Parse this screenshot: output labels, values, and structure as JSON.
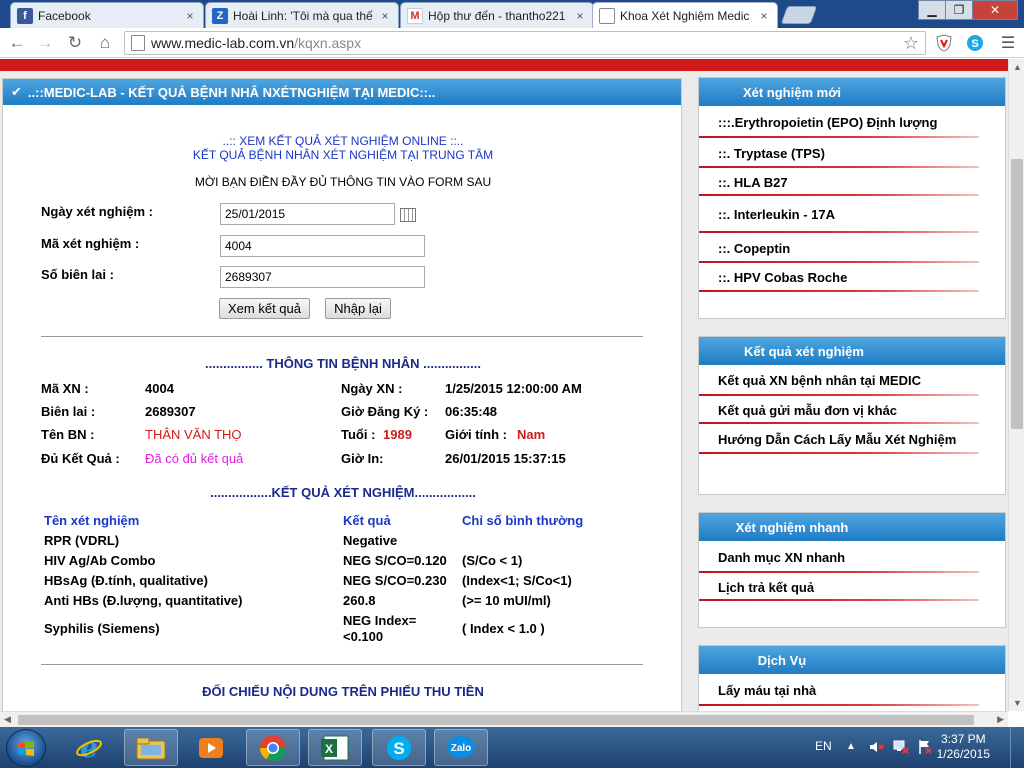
{
  "browser": {
    "tabs": [
      {
        "title": "Facebook",
        "favicon": "f",
        "color": "#3b5998"
      },
      {
        "title": "Hoài Linh: 'Tôi mà qua thế",
        "favicon": "Z",
        "color": "#1e66c8"
      },
      {
        "title": "Hộp thư đến - thantho221",
        "favicon": "M",
        "color": "#d93025"
      },
      {
        "title": "Khoa Xét Nghiệm Medic -",
        "favicon": "",
        "color": "#ffffff"
      }
    ],
    "close_glyph": "×",
    "url_host": "www.medic-lab.com.vn",
    "url_path": "/kqxn.aspx"
  },
  "main": {
    "header": "..::MEDIC-LAB   -   KẾT QUẢ BỆNH NHÂ NXÉTNGHIỆM TẠI MEDIC::..",
    "intro_line1": "..:: XEM KẾT QUẢ XÉT NGHIỆM ONLINE ::..",
    "intro_line2": "KẾT QUẢ BỆNH NHÂN XÉT NGHIỆM TẠI TRUNG TÂM",
    "instruction": "MỜI BẠN ĐIỀN ĐẦY ĐỦ THÔNG TIN VÀO FORM SAU",
    "form": {
      "date_label": "Ngày xét nghiệm :",
      "date_value": "25/01/2015",
      "code_label": "Mã xét nghiệm :",
      "code_value": "4004",
      "receipt_label": "Số biên lai :",
      "receipt_value": "2689307",
      "view_button": "Xem kết quả",
      "reset_button": "Nhập lại"
    },
    "patient": {
      "title": "................ THÔNG TIN BỆNH NHÂN ................",
      "ma_xn_label": "Mã XN :",
      "ma_xn": "4004",
      "ngay_xn_label": "Ngày XN :",
      "ngay_xn": "1/25/2015 12:00:00 AM",
      "bien_lai_label": "Biên lai :",
      "bien_lai": "2689307",
      "gio_dk_label": "Giờ Đăng Ký :",
      "gio_dk": "06:35:48",
      "ten_bn_label": "Tên BN :",
      "ten_bn": "THÂN VĂN THỌ",
      "tuoi_label": "Tuổi :",
      "tuoi": "1989",
      "gioi_tinh_label": "Giới tính :",
      "gioi_tinh": "Nam",
      "du_kq_label": "Đủ Kết Quả :",
      "du_kq": "Đã có đủ kết quả",
      "gio_in_label": "Giờ In:",
      "gio_in": "26/01/2015 15:37:15"
    },
    "results": {
      "title": ".................KẾT QUẢ XÉT NGHIỆM.................",
      "col_name": "Tên xét nghiệm",
      "col_result": "Kết quả",
      "col_normal": "Chỉ số bình thường",
      "rows": [
        {
          "name": "RPR (VDRL)",
          "result": "Negative",
          "normal": ""
        },
        {
          "name": "HIV Ag/Ab Combo",
          "result": "NEG S/CO=0.120",
          "normal": "(S/Co < 1)"
        },
        {
          "name": "HBsAg (Đ.tính, qualitative)",
          "result": "NEG S/CO=0.230",
          "normal": "(Index<1; S/Co<1)"
        },
        {
          "name": "Anti HBs (Đ.lượng, quantitative)",
          "result": "260.8",
          "normal": "(>= 10 mUI/ml)"
        },
        {
          "name": "Syphilis (Siemens)",
          "result_line1": "NEG Index=",
          "result_line2": "<0.100",
          "normal": "( Index < 1.0 )"
        }
      ]
    },
    "compare_title": "ĐỐI CHIẾU NỘI DUNG TRÊN PHIẾU THU TIỀN"
  },
  "sidebar": {
    "new_tests": {
      "title": "Xét nghiệm mới",
      "items": [
        ":::.Erythropoietin (EPO) Định  lượng",
        "::. Tryptase (TPS)",
        "::. HLA B27",
        "::. Interleukin - 17A",
        "::. Copeptin",
        "::. HPV Cobas Roche"
      ]
    },
    "results": {
      "title": "Kết quả xét nghiệm",
      "items": [
        "Kết quả XN bệnh nhân tại MEDIC",
        "Kết quả gửi mẫu đơn vị khác",
        "Hướng Dẫn Cách Lấy Mẫu Xét Nghiệm"
      ]
    },
    "quick": {
      "title": "Xét nghiệm nhanh",
      "items": [
        "Danh mục XN nhanh",
        "Lịch trả kết quả"
      ]
    },
    "services": {
      "title": "Dịch Vụ",
      "items": [
        "Lấy máu tại nhà"
      ]
    }
  },
  "taskbar": {
    "lang": "EN",
    "time": "3:37 PM",
    "date": "1/26/2015"
  }
}
